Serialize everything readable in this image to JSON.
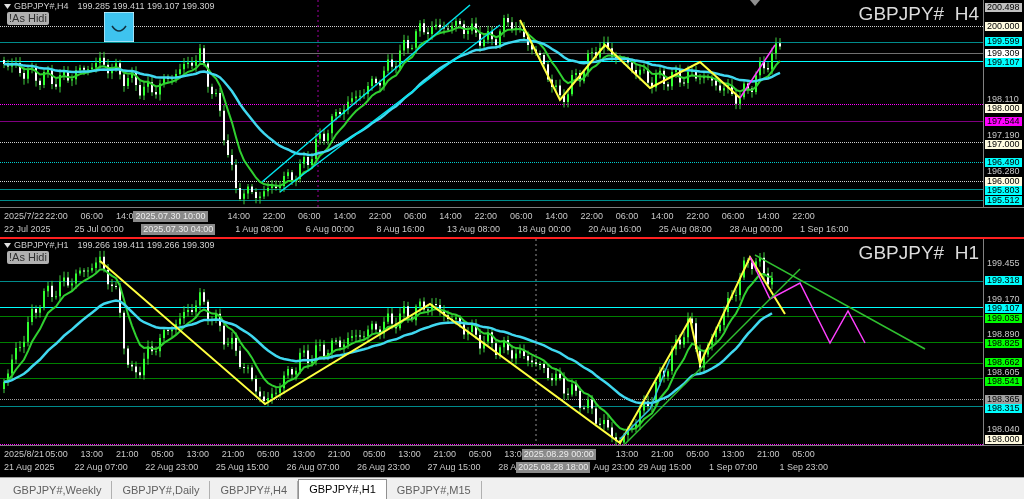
{
  "panes": [
    {
      "symbol": "GBPJPY#,H4",
      "ohlc": "199.285 199.411 199.107 199.309",
      "badge": "!As Hidi",
      "title": "GBPJPY#  H4",
      "price_labels": [
        {
          "text": "200.498",
          "kind": "box",
          "color": "#c0c0c0"
        },
        {
          "text": "200.000",
          "kind": "box",
          "color": "#fffbe0",
          "line": {
            "color": "#d0d0d0",
            "dashed": true
          }
        },
        {
          "text": "199.599",
          "kind": "box",
          "color": "#00ffff",
          "line": {
            "color": "#008b8b",
            "dashed": false
          }
        },
        {
          "text": "199.309",
          "kind": "box",
          "color": "#ffffff",
          "line": {
            "color": "#707070",
            "dashed": false
          }
        },
        {
          "text": "199.107",
          "kind": "box",
          "color": "#00ffff",
          "line": {
            "color": "#00ffff",
            "dashed": false
          }
        },
        {
          "text": "198.110",
          "kind": "tick"
        },
        {
          "text": "198.000",
          "kind": "box",
          "color": "#fffbe0",
          "line": {
            "color": "#ff00ff",
            "dashed": true
          }
        },
        {
          "text": "197.544",
          "kind": "box",
          "color": "#ff00ff",
          "line": {
            "color": "#800080",
            "dashed": false
          }
        },
        {
          "text": "197.190",
          "kind": "tick"
        },
        {
          "text": "197.000",
          "kind": "box",
          "color": "#fffbe0",
          "line": {
            "color": "#d0d0d0",
            "dashed": true
          }
        },
        {
          "text": "196.490",
          "kind": "box",
          "color": "#00ffff",
          "line": {
            "color": "#00cccc",
            "dashed": true
          }
        },
        {
          "text": "196.280",
          "kind": "tick"
        },
        {
          "text": "196.000",
          "kind": "box",
          "color": "#fffbe0",
          "line": {
            "color": "#d0d0d0",
            "dashed": true
          }
        },
        {
          "text": "195.803",
          "kind": "box",
          "color": "#00ffff",
          "line": {
            "color": "#008b8b",
            "dashed": false
          }
        },
        {
          "text": "195.512",
          "kind": "box",
          "color": "#00ffff",
          "line": {
            "color": "#008b8b",
            "dashed": false
          }
        }
      ],
      "time_axis": {
        "upper": [
          {
            "text": "2025/7/22",
            "kind": "tick"
          },
          {
            "text": "22:00",
            "kind": "tick"
          },
          {
            "text": "06:00",
            "kind": "tick"
          },
          {
            "text": "14:0",
            "kind": "cut"
          },
          {
            "text": "2025.07.30 10:00",
            "kind": "cursor"
          },
          {
            "text": "14:00",
            "kind": "tick"
          },
          {
            "text": "22:00",
            "kind": "tick"
          },
          {
            "text": "06:00",
            "kind": "tick"
          },
          {
            "text": "14:00",
            "kind": "tick"
          },
          {
            "text": "22:00",
            "kind": "tick"
          },
          {
            "text": "06:00",
            "kind": "tick"
          },
          {
            "text": "14:00",
            "kind": "tick"
          },
          {
            "text": "22:00",
            "kind": "tick"
          },
          {
            "text": "06:00",
            "kind": "tick"
          },
          {
            "text": "14:00",
            "kind": "tick"
          },
          {
            "text": "22:00",
            "kind": "tick"
          },
          {
            "text": "06:00",
            "kind": "tick"
          },
          {
            "text": "14:00",
            "kind": "tick"
          },
          {
            "text": "22:00",
            "kind": "tick"
          },
          {
            "text": "06:00",
            "kind": "tick"
          },
          {
            "text": "14:00",
            "kind": "tick"
          },
          {
            "text": "22:00",
            "kind": "tick"
          }
        ],
        "lower": [
          {
            "text": "22 Jul 2025",
            "kind": "tick"
          },
          {
            "text": "25 Jul 00:00",
            "kind": "tick"
          },
          {
            "text": "2025.07.30 04:00",
            "kind": "cursor"
          },
          {
            "text": "1 Aug 08:00",
            "kind": "tick"
          },
          {
            "text": "6 Aug 00:00",
            "kind": "tick"
          },
          {
            "text": "8 Aug 16:00",
            "kind": "tick"
          },
          {
            "text": "13 Aug 08:00",
            "kind": "tick"
          },
          {
            "text": "18 Aug 00:00",
            "kind": "tick"
          },
          {
            "text": "20 Aug 16:00",
            "kind": "tick"
          },
          {
            "text": "25 Aug 08:00",
            "kind": "tick"
          },
          {
            "text": "28 Aug 00:00",
            "kind": "tick"
          },
          {
            "text": "1 Sep 16:00",
            "kind": "tick"
          }
        ]
      }
    },
    {
      "symbol": "GBPJPY#,H1",
      "ohlc": "199.266 199.411 199.266 199.309",
      "badge": "!As Hidi",
      "title": "GBPJPY#  H1",
      "price_labels": [
        {
          "text": "199.455",
          "kind": "tick"
        },
        {
          "text": "199.318",
          "kind": "box",
          "color": "#00ffff",
          "line": {
            "color": "#008b8b",
            "dashed": false
          }
        },
        {
          "text": "199.170",
          "kind": "tick"
        },
        {
          "text": "199.107",
          "kind": "box",
          "color": "#00ffff",
          "line": {
            "color": "#00ffff",
            "dashed": false
          }
        },
        {
          "text": "199.035",
          "kind": "box",
          "color": "#00ff00",
          "line": {
            "color": "#008000",
            "dashed": false
          }
        },
        {
          "text": "198.890",
          "kind": "tick"
        },
        {
          "text": "198.825",
          "kind": "box",
          "color": "#00ff00",
          "line": {
            "color": "#008000",
            "dashed": false
          }
        },
        {
          "text": "198.662",
          "kind": "box",
          "color": "#00ff00",
          "line": {
            "color": "#008000",
            "dashed": false
          }
        },
        {
          "text": "198.605",
          "kind": "tick"
        },
        {
          "text": "198.541",
          "kind": "box",
          "color": "#00ff00",
          "line": {
            "color": "#008000",
            "dashed": false
          }
        },
        {
          "text": "198.365",
          "kind": "box",
          "color": "#a0a0a0",
          "line": {
            "color": "#a0a0a0",
            "dashed": true
          }
        },
        {
          "text": "198.315",
          "kind": "box",
          "color": "#00ffff",
          "line": {
            "color": "#008b8b",
            "dashed": false
          }
        },
        {
          "text": "198.040",
          "kind": "tick"
        },
        {
          "text": "198.000",
          "kind": "box",
          "color": "#fffbe0",
          "line": {
            "color": "#ff00ff",
            "dashed": true
          }
        }
      ],
      "time_axis": {
        "upper": [
          {
            "text": "2025/8/21",
            "kind": "tick"
          },
          {
            "text": "05:00",
            "kind": "tick"
          },
          {
            "text": "13:00",
            "kind": "tick"
          },
          {
            "text": "21:00",
            "kind": "tick"
          },
          {
            "text": "05:00",
            "kind": "tick"
          },
          {
            "text": "13:00",
            "kind": "tick"
          },
          {
            "text": "21:00",
            "kind": "tick"
          },
          {
            "text": "05:00",
            "kind": "tick"
          },
          {
            "text": "13:00",
            "kind": "tick"
          },
          {
            "text": "21:00",
            "kind": "tick"
          },
          {
            "text": "05:00",
            "kind": "tick"
          },
          {
            "text": "13:00",
            "kind": "tick"
          },
          {
            "text": "21:00",
            "kind": "tick"
          },
          {
            "text": "05:00",
            "kind": "tick"
          },
          {
            "text": "13:0",
            "kind": "cut"
          },
          {
            "text": "2025.08.29 00:00",
            "kind": "cursor"
          },
          {
            "text": "13:00",
            "kind": "tick"
          },
          {
            "text": "21:00",
            "kind": "tick"
          },
          {
            "text": "05:00",
            "kind": "tick"
          },
          {
            "text": "13:00",
            "kind": "tick"
          },
          {
            "text": "21:00",
            "kind": "tick"
          },
          {
            "text": "05:00",
            "kind": "tick"
          }
        ],
        "lower": [
          {
            "text": "21 Aug 2025",
            "kind": "tick"
          },
          {
            "text": "22 Aug 07:00",
            "kind": "tick"
          },
          {
            "text": "22 Aug 23:00",
            "kind": "tick"
          },
          {
            "text": "25 Aug 15:00",
            "kind": "tick"
          },
          {
            "text": "26 Aug 07:00",
            "kind": "tick"
          },
          {
            "text": "26 Aug 23:00",
            "kind": "tick"
          },
          {
            "text": "27 Aug 15:00",
            "kind": "tick"
          },
          {
            "text": "28 A",
            "kind": "cut"
          },
          {
            "text": "2025.08.28 18:00",
            "kind": "cursor"
          },
          {
            "text": "Aug 23:00",
            "kind": "cut"
          },
          {
            "text": "29 Aug 15:00",
            "kind": "tick"
          },
          {
            "text": "1 Sep 07:00",
            "kind": "tick"
          },
          {
            "text": "1 Sep 23:00",
            "kind": "tick"
          }
        ]
      }
    }
  ],
  "tabs": [
    {
      "label": "GBPJPY#,Weekly",
      "selected": false
    },
    {
      "label": "GBPJPY#,Daily",
      "selected": false
    },
    {
      "label": "GBPJPY#,H4",
      "selected": false
    },
    {
      "label": "GBPJPY#,H1",
      "selected": true
    },
    {
      "label": "GBPJPY#,M15",
      "selected": false
    }
  ]
}
